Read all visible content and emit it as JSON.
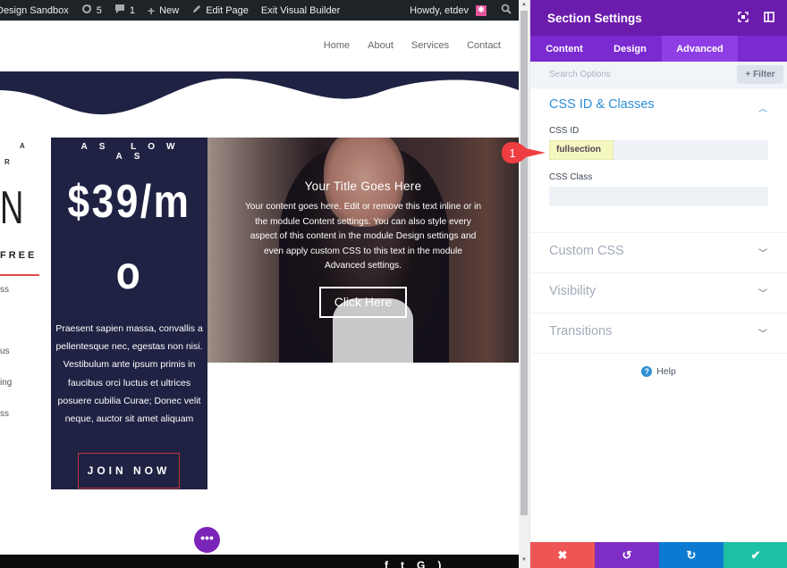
{
  "admin_bar": {
    "site_name": "Design Sandbox",
    "updates_count": "5",
    "comments_count": "1",
    "new_label": "New",
    "edit_page_label": "Edit Page",
    "exit_builder_label": "Exit Visual Builder",
    "greeting": "Howdy, etdev"
  },
  "nav": {
    "items": [
      "Home",
      "About",
      "Services",
      "Contact"
    ]
  },
  "left_column": {
    "small_a": "A",
    "small_r": "R",
    "big_letter": "N",
    "free_label": "FREE",
    "list": [
      "ss",
      "us",
      "ing",
      "ss"
    ],
    "accent_color": "#e04b4b"
  },
  "price_card": {
    "eyebrow": "AS LOW AS",
    "price_line1": "$39/m",
    "price_line2": "o",
    "description": "Praesent sapien massa, convallis a pellentesque nec, egestas non nisi. Vestibulum ante ipsum primis in faucibus orci luctus et ultrices posuere cubilia Curae; Donec velit neque, auctor sit amet aliquam",
    "button_label": "JOIN NOW",
    "bg_color": "#1f2243"
  },
  "image_card": {
    "title": "Your Title Goes Here",
    "body": "Your content goes here. Edit or remove this text inline or in the module Content settings. You can also style every aspect of this content in the module Design settings and even apply custom CSS to this text in the module Advanced settings.",
    "button_label": "Click Here"
  },
  "builder": {
    "dots_label": "•••"
  },
  "callout": {
    "number": "1",
    "color": "#ef3e42"
  },
  "panel": {
    "title": "Section Settings",
    "header_color": "#6c1cad",
    "tabs": [
      {
        "label": "Content",
        "active": false
      },
      {
        "label": "Design",
        "active": false
      },
      {
        "label": "Advanced",
        "active": true
      }
    ],
    "search_placeholder": "Search Options",
    "filter_label": "+ Filter",
    "groups": [
      {
        "title": "CSS ID & Classes",
        "open": true
      },
      {
        "title": "Custom CSS",
        "open": false
      },
      {
        "title": "Visibility",
        "open": false
      },
      {
        "title": "Transitions",
        "open": false
      }
    ],
    "css_id_label": "CSS ID",
    "css_id_value": "fullsection",
    "css_class_label": "CSS Class",
    "css_class_value": "",
    "help_label": "Help",
    "actions": {
      "cancel_color": "#ef5555",
      "undo_color": "#7e2ec4",
      "redo_color": "#0c7ad1",
      "save_color": "#1ec1a4"
    }
  }
}
